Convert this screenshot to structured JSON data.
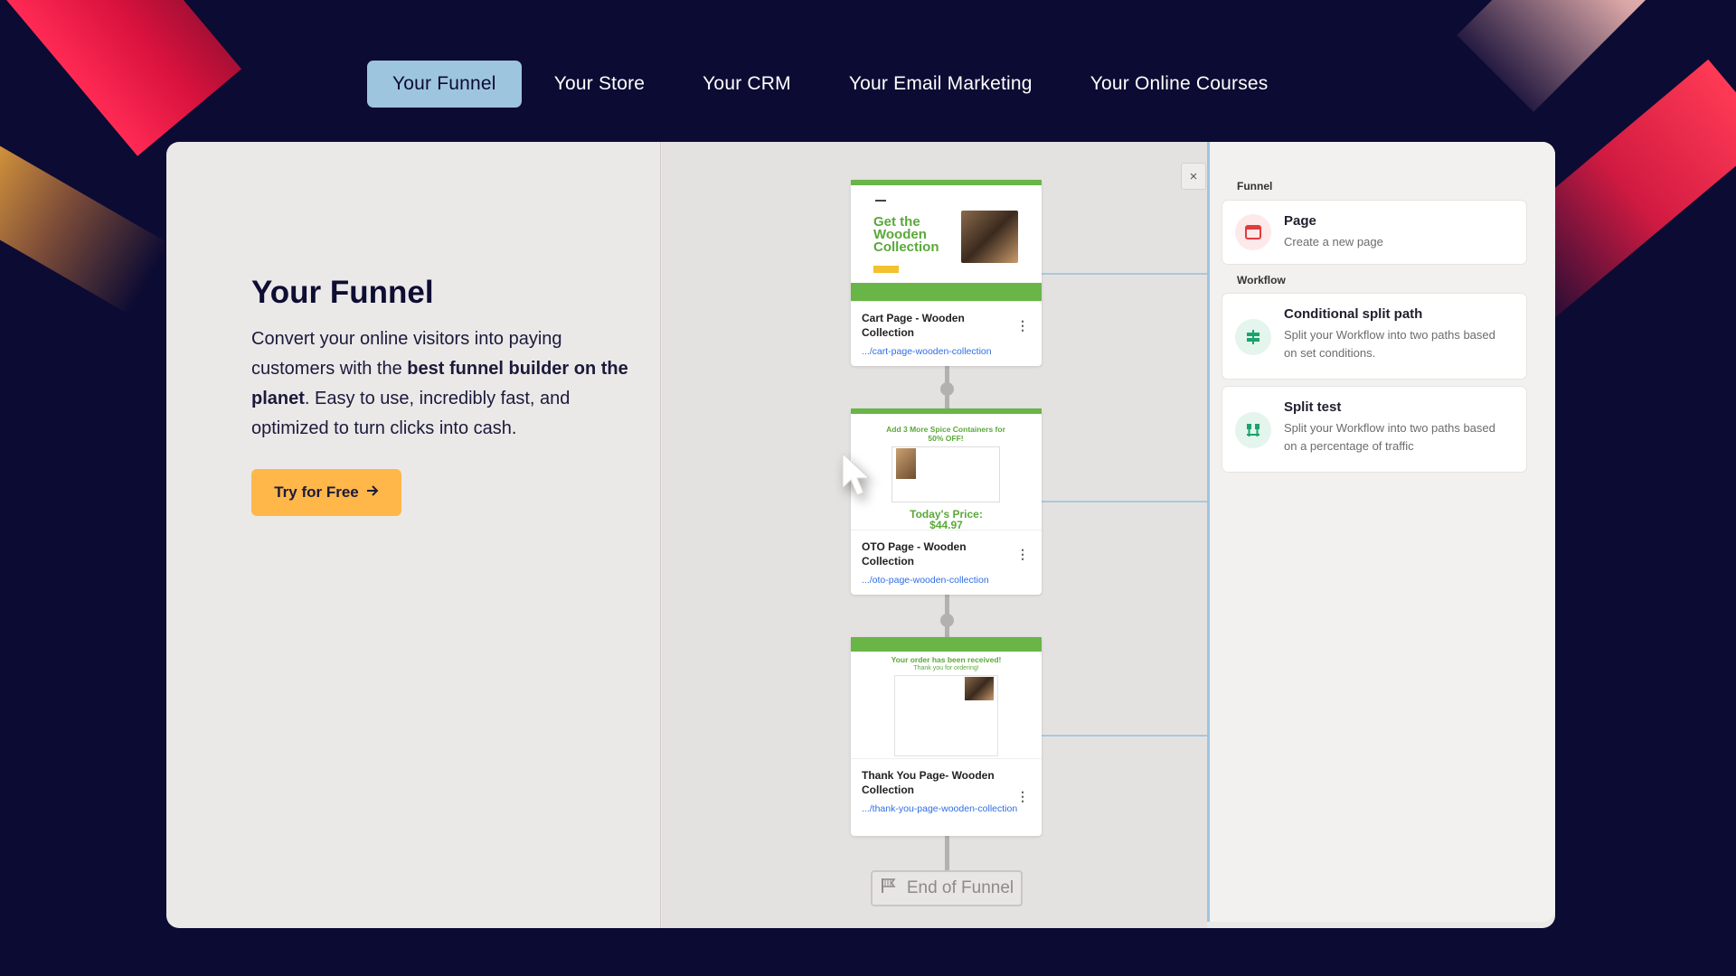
{
  "nav": {
    "tabs": [
      {
        "label": "Your Funnel",
        "active": true
      },
      {
        "label": "Your Store",
        "active": false
      },
      {
        "label": "Your CRM",
        "active": false
      },
      {
        "label": "Your Email Marketing",
        "active": false
      },
      {
        "label": "Your Online Courses",
        "active": false
      }
    ]
  },
  "hero": {
    "title": "Your Funnel",
    "text_part1": "Convert your online visitors into paying customers with the ",
    "text_bold": "best funnel builder on the planet",
    "text_part2": ". Easy to use, incredibly fast, and optimized to turn clicks into cash.",
    "cta_label": "Try for Free"
  },
  "funnel": {
    "close_label": "×",
    "pages": [
      {
        "title": "Cart Page - Wooden Collection",
        "link": ".../cart-page-wooden-collection",
        "thumb_heading": "Get the Wooden Collection"
      },
      {
        "title": "OTO Page - Wooden Collection",
        "link": ".../oto-page-wooden-collection",
        "thumb_heading": "Add 3 More Spice Containers for 50% OFF!",
        "thumb_price_label": "Today's Price:",
        "thumb_price": "$44.97"
      },
      {
        "title": "Thank You Page- Wooden Collection",
        "link": ".../thank-you-page-wooden-collection",
        "thumb_heading": "Your order has been received!",
        "thumb_sub": "Thank you for ordering!"
      }
    ],
    "end_label": "End of Funnel"
  },
  "panel": {
    "funnel_label": "Funnel",
    "workflow_label": "Workflow",
    "tools": [
      {
        "title": "Page",
        "desc": "Create a new page",
        "icon": "page-icon",
        "color": "#e23b3b"
      },
      {
        "title": "Conditional split path",
        "desc": "Split your Workflow into two paths based on set conditions.",
        "icon": "split-path-icon",
        "color": "#1aa36b"
      },
      {
        "title": "Split test",
        "desc": "Split your Workflow into two paths based on a percentage of traffic",
        "icon": "split-test-icon",
        "color": "#1aa36b"
      }
    ]
  },
  "colors": {
    "background": "#0c0b33",
    "active_tab": "#9ec5de",
    "cta": "#ffb74a",
    "link": "#2e6de4",
    "thumb_green": "#69b547"
  }
}
